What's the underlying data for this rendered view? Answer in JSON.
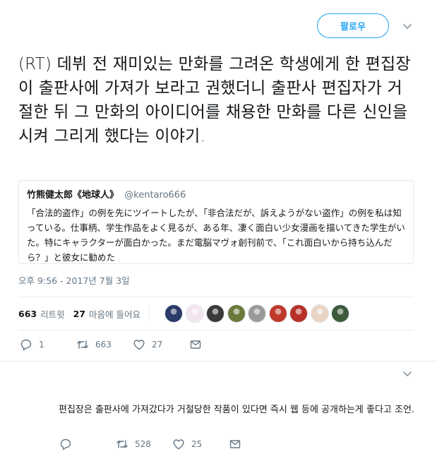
{
  "header": {
    "follow_label": "팔로우"
  },
  "tweet": {
    "text": "(RT) 데뷔 전 재미있는 만화를 그려온 학생에게 한 편집장이 출판사에 가져가 보라고 권했더니 출판사 편집자가 거절한 뒤 그 만화의 아이디어를 채용한 만화를 다른 신인을 시켜 그리게 했다는 이야기.",
    "quote": {
      "name": "竹熊健太郎《地球人》",
      "handle": "@kentaro666",
      "body": "「合法的盗作」の例を先にツイートしたが、「非合法だが、訴えようがない盗作」の例を私は知っている。仕事柄、学生作品をよく見るが、ある年、凄く面白い少女漫画を描いてきた学生がいた。特にキャラクターが面白かった。まだ電脳マヴォ創刊前で、「これ面白いから持ち込んだら？」と彼女に勧めた"
    },
    "timestamp": "오후 9:56 - 2017년 7월 3일",
    "stats": {
      "retweets_num": "663",
      "retweets_label": "리트윗",
      "likes_num": "27",
      "likes_label": "마음에 들어요"
    },
    "avatar_colors": [
      "#2b3a67",
      "#f3e6ef",
      "#3a3a3a",
      "#6b7a3a",
      "#9a9a9a",
      "#c0392b",
      "#b8302a",
      "#e9d4c4",
      "#3d5a3a"
    ],
    "actions": {
      "reply_count": "1",
      "retweet_count": "663",
      "like_count": "27"
    }
  },
  "reply": {
    "text": "편집장은 출판사에 가져갔다가 거절당한 작품이 있다면 즉시 웹 등에 공개하는게 좋다고 조언.",
    "actions": {
      "retweet_count": "528",
      "like_count": "25"
    }
  },
  "colors": {
    "accent": "#1da1f2",
    "muted": "#657786",
    "border": "#e6ecf0"
  }
}
